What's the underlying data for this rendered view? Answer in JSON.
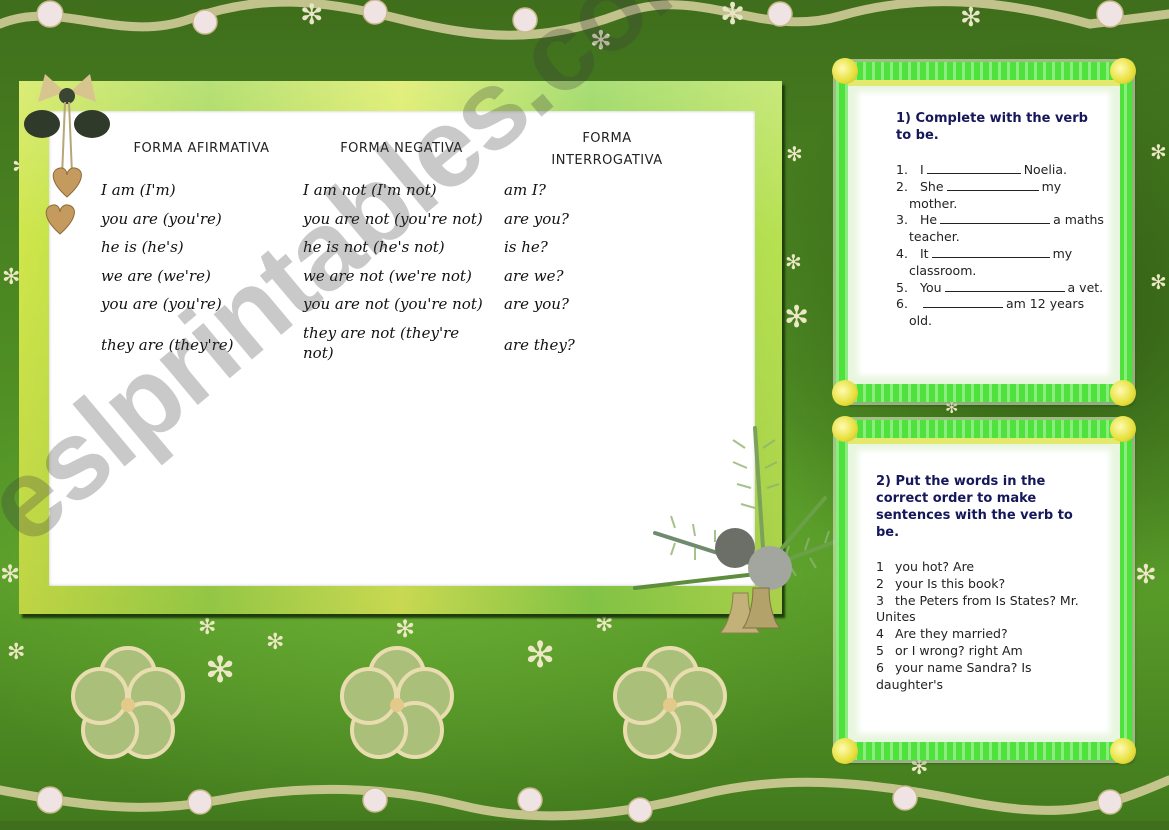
{
  "worksheet": {
    "columns": [
      "FORMA AFIRMATIVA",
      "FORMA NEGATIVA",
      "FORMA INTERROGATIVA"
    ],
    "rows": [
      {
        "affirmative": "I am (I'm)",
        "negative": "I am not (I'm not)",
        "interrogative": "am I?"
      },
      {
        "affirmative": "you are (you're)",
        "negative": "you are not (you're not)",
        "interrogative": "are you?"
      },
      {
        "affirmative": "he is (he's)",
        "negative": "he is not (he's not)",
        "interrogative": "is he?"
      },
      {
        "affirmative": "we are (we're)",
        "negative": "we are not (we're not)",
        "interrogative": "are we?"
      },
      {
        "affirmative": "you are (you're)",
        "negative": "you are not (you're not)",
        "interrogative": "are you?"
      },
      {
        "affirmative": "they are (they're)",
        "negative": "they are not (they're not)",
        "interrogative": "are they?"
      }
    ]
  },
  "exercise1": {
    "title": "1) Complete with the verb to be.",
    "items": [
      {
        "num": "1.",
        "before": "I",
        "after": "Noelia."
      },
      {
        "num": "2.",
        "before": "She",
        "after": "my mother."
      },
      {
        "num": "3.",
        "before": "He",
        "after": "a maths teacher."
      },
      {
        "num": "4.",
        "before": "It",
        "after": "my classroom."
      },
      {
        "num": "5.",
        "before": "You",
        "after": "a vet."
      },
      {
        "num": "6.",
        "before": "",
        "after": "am 12 years old."
      }
    ]
  },
  "exercise2": {
    "title": "2) Put the words in the correct order to make sentences with the verb to be.",
    "items": [
      {
        "num": "1",
        "text": "you hot? Are"
      },
      {
        "num": "2",
        "text": "your Is this book?"
      },
      {
        "num": "3",
        "text": "the Peters from Is States? Mr. Unites"
      },
      {
        "num": "4",
        "text": "Are they married?"
      },
      {
        "num": "5",
        "text": "or I wrong? right Am"
      },
      {
        "num": "6",
        "text": "your name Sandra? Is daughter's"
      }
    ]
  },
  "watermark": "eslprintables.com",
  "decorations": {
    "icons": [
      "garland-icon",
      "bow-hearts-ornament-icon",
      "pine-bells-ornament-icon",
      "flower-icon",
      "snowflake-icon"
    ]
  },
  "colors": {
    "background_green": "#4d8a23",
    "frame_lime": "#cfe64a",
    "side_frame_green": "#4fe23c",
    "exercise_title": "#15175a"
  }
}
